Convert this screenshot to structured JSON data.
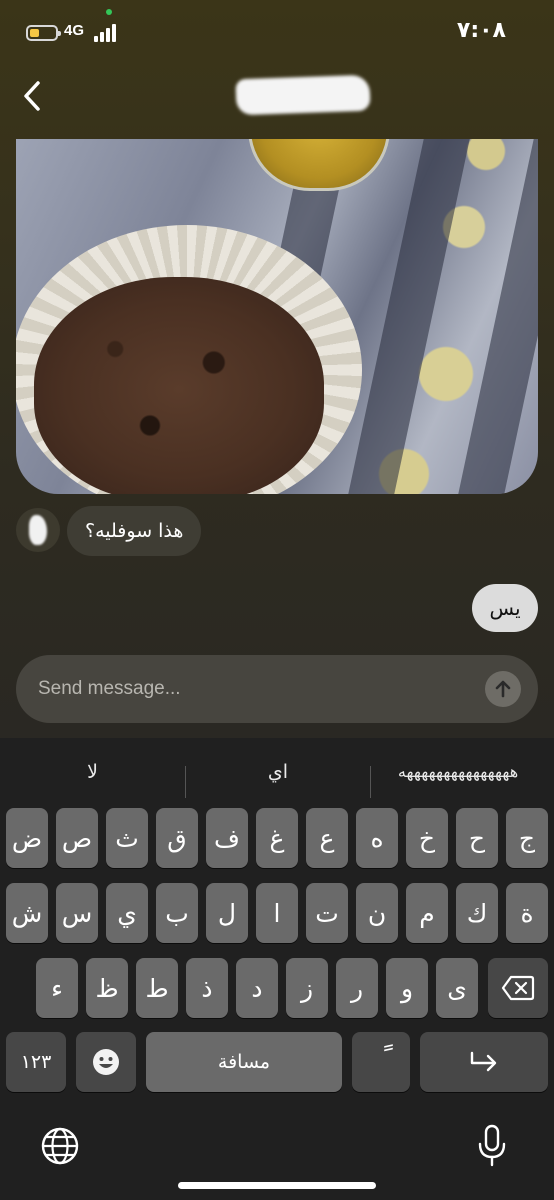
{
  "status_bar": {
    "network": "4G",
    "time": "٧:٠٨",
    "battery_level": 0.3
  },
  "header": {
    "back_icon": "chevron-left-icon"
  },
  "messages": [
    {
      "side": "received",
      "text": "هذا سوفليه؟"
    },
    {
      "side": "sent",
      "text": "يس"
    }
  ],
  "composer": {
    "placeholder": "Send message...",
    "send_icon": "arrow-up-icon"
  },
  "keyboard": {
    "suggestions": [
      "هههههههههههههههه",
      "اي",
      "لا"
    ],
    "row1": [
      "ج",
      "ح",
      "خ",
      "ه",
      "ع",
      "غ",
      "ف",
      "ق",
      "ث",
      "ص",
      "ض"
    ],
    "row2": [
      "ة",
      "ك",
      "م",
      "ن",
      "ت",
      "ا",
      "ل",
      "ب",
      "ي",
      "س",
      "ش"
    ],
    "row3": [
      "ى",
      "و",
      "ر",
      "ز",
      "د",
      "ذ",
      "ط",
      "ظ",
      "ء"
    ],
    "numbers_key": "١٢٣",
    "space_key": "مسافة",
    "diacritic_key": "ً",
    "emoji_icon": "emoji-icon",
    "delete_icon": "backspace-icon",
    "return_icon": "return-icon",
    "globe_icon": "globe-icon",
    "mic_icon": "microphone-icon"
  },
  "colors": {
    "accent_green": "#34c759",
    "battery_yellow": "#f6c744",
    "sent_bubble": "#dcdcdc",
    "received_bubble": "#3f3d34"
  }
}
